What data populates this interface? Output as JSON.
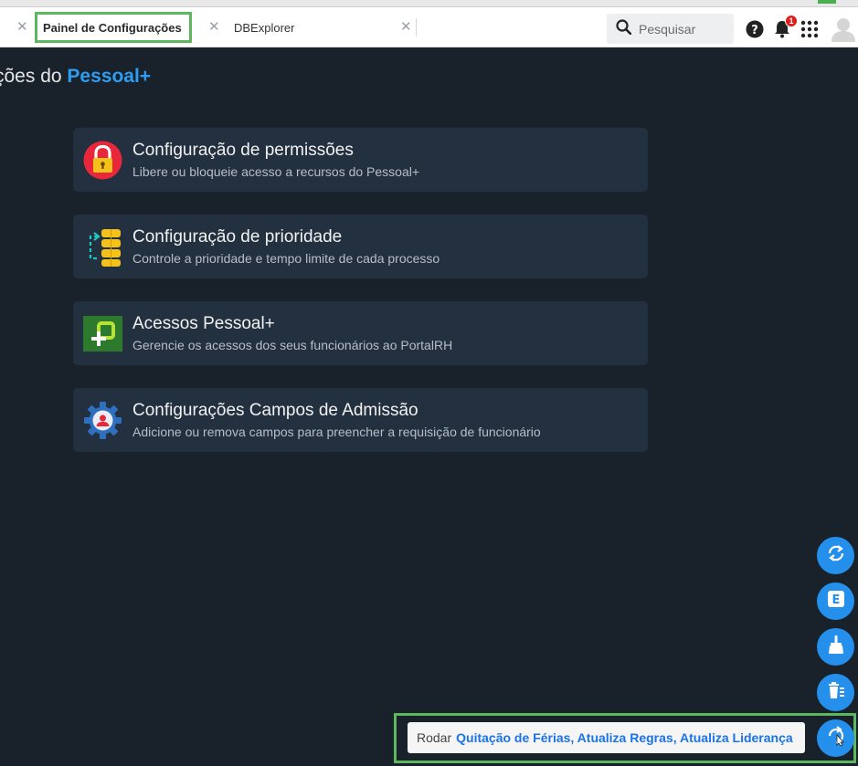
{
  "tabs": [
    {
      "label": "Painel de Configurações",
      "active": true
    },
    {
      "label": "DBExplorer",
      "active": false
    }
  ],
  "search": {
    "placeholder": "Pesquisar"
  },
  "notifications": {
    "count": "1"
  },
  "page": {
    "title_prefix": "ções do",
    "title_brand": "Pessoal+"
  },
  "cards": [
    {
      "title": "Configuração de permissões",
      "description": "Libere ou bloqueie acesso a recursos do Pessoal+",
      "icon": "lock-icon"
    },
    {
      "title": "Configuração de prioridade",
      "description": "Controle a prioridade e tempo limite de cada processo",
      "icon": "priority-stack-icon"
    },
    {
      "title": "Acessos Pessoal+",
      "description": "Gerencie os acessos dos seus funcionários ao PortalRH",
      "icon": "access-plus-icon"
    },
    {
      "title": "Configurações Campos de Admissão",
      "description": "Adicione ou remova campos para preencher a requisição de funcionário",
      "icon": "admission-gear-icon"
    }
  ],
  "fab_buttons": [
    "sync-icon",
    "e-letter-icon",
    "broom-icon",
    "clear-list-icon",
    "refresh-run-icon"
  ],
  "tooltip": {
    "prefix": "Rodar",
    "items": "Quitação de Férias, Atualiza Regras, Atualiza Liderança"
  },
  "colors": {
    "background": "#19212b",
    "card": "#233040",
    "accent": "#2590eb",
    "brand": "#2e9cf0",
    "highlight": "#5cb85c"
  }
}
